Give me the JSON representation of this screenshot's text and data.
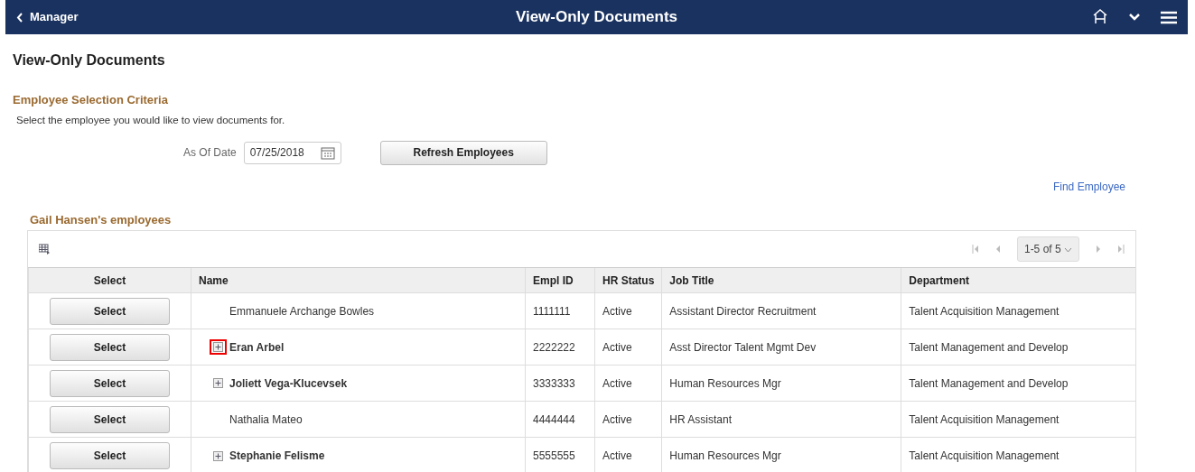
{
  "banner": {
    "back": "Manager",
    "title": "View-Only Documents"
  },
  "page_title": "View-Only Documents",
  "criteria": {
    "heading": "Employee Selection Criteria",
    "instructions": "Select the employee you would like to view documents for.",
    "date_label": "As Of Date",
    "date_value": "07/25/2018",
    "refresh_button": "Refresh Employees"
  },
  "find_link": "Find Employee",
  "grid": {
    "title": "Gail Hansen's employees",
    "pagination": "1-5 of 5",
    "columns": [
      "Select",
      "Name",
      "Empl ID",
      "HR Status",
      "Job Title",
      "Department"
    ],
    "rows": [
      {
        "button": "Select",
        "name": "Emmanuele Archange Bowles",
        "expandable": false,
        "highlighted": false,
        "empl_id": "1111111",
        "hr_status": "Active",
        "job_title": "Assistant Director Recruitment",
        "department": "Talent Acquisition Management"
      },
      {
        "button": "Select",
        "name": "Eran Arbel",
        "expandable": true,
        "highlighted": true,
        "empl_id": "2222222",
        "hr_status": "Active",
        "job_title": "Asst Director Talent Mgmt Dev",
        "department": "Talent Management and Develop"
      },
      {
        "button": "Select",
        "name": "Joliett Vega-Klucevsek",
        "expandable": true,
        "highlighted": false,
        "empl_id": "3333333",
        "hr_status": "Active",
        "job_title": "Human Resources Mgr",
        "department": "Talent Management and Develop"
      },
      {
        "button": "Select",
        "name": "Nathalia Mateo",
        "expandable": false,
        "highlighted": false,
        "empl_id": "4444444",
        "hr_status": "Active",
        "job_title": "HR Assistant",
        "department": "Talent Acquisition Management"
      },
      {
        "button": "Select",
        "name": "Stephanie Felisme",
        "expandable": true,
        "highlighted": false,
        "empl_id": "5555555",
        "hr_status": "Active",
        "job_title": "Human Resources Mgr",
        "department": "Talent Acquisition Management"
      }
    ]
  }
}
